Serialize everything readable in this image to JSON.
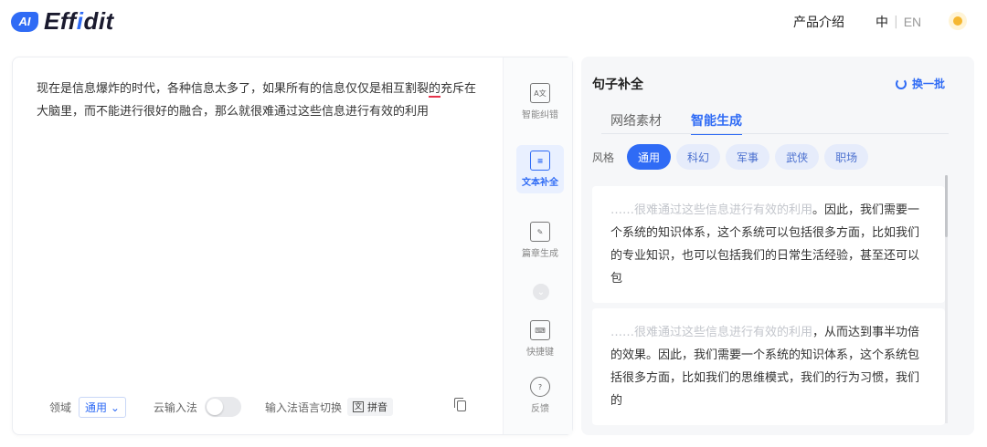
{
  "header": {
    "logo_ai": "AI",
    "logo_pre": "Eff",
    "logo_hl": "i",
    "logo_post": "dit",
    "nav_intro": "产品介绍",
    "lang_zh": "中",
    "lang_sep": "|",
    "lang_en": "EN",
    "theme_icon": "sun-icon"
  },
  "editor": {
    "text_before": "现在是信息爆炸的时代，各种信息太多了，如果所有的信息仅仅是相互割裂",
    "text_error": "的",
    "text_after": "充斥在大脑里，而不能进行很好的融合，那么就很难通过这些信息进行有效的利用",
    "error_color": "#e6334a"
  },
  "bottom_bar": {
    "domain_label": "领域",
    "domain_value": "通用",
    "cloud_ime_label": "云输入法",
    "cloud_ime_on": false,
    "ime_switch_label": "输入法语言切换",
    "ime_value": "拼音"
  },
  "tools": [
    {
      "label": "智能纠错",
      "icon": "text-scan-icon",
      "active": false
    },
    {
      "label": "文本补全",
      "icon": "document-icon",
      "active": true
    },
    {
      "label": "篇章生成",
      "icon": "article-gen-icon",
      "active": false
    },
    {
      "label": "快捷键",
      "icon": "keyboard-icon",
      "active": false
    },
    {
      "label": "反馈",
      "icon": "question-icon",
      "active": false
    }
  ],
  "panel": {
    "title": "句子补全",
    "refresh_label": "换一批",
    "tabs": [
      "网络素材",
      "智能生成"
    ],
    "active_tab": "智能生成",
    "style_label": "风格",
    "styles": [
      "通用",
      "科幻",
      "军事",
      "武侠",
      "职场"
    ],
    "active_style": "通用",
    "suggestions": [
      {
        "context": "……很难通过这些信息进行有效的利用",
        "text": "。因此，我们需要一个系统的知识体系，这个系统可以包括很多方面，比如我们的专业知识，也可以包括我们的日常生活经验，甚至还可以包"
      },
      {
        "context": "……很难通过这些信息进行有效的利用",
        "text": "，从而达到事半功倍的效果。因此，我们需要一个系统的知识体系，这个系统包括很多方面，比如我们的思维模式，我们的行为习惯，我们的"
      }
    ]
  },
  "colors": {
    "accent": "#2f6bf5",
    "panel_bg": "#f6f7f9"
  }
}
